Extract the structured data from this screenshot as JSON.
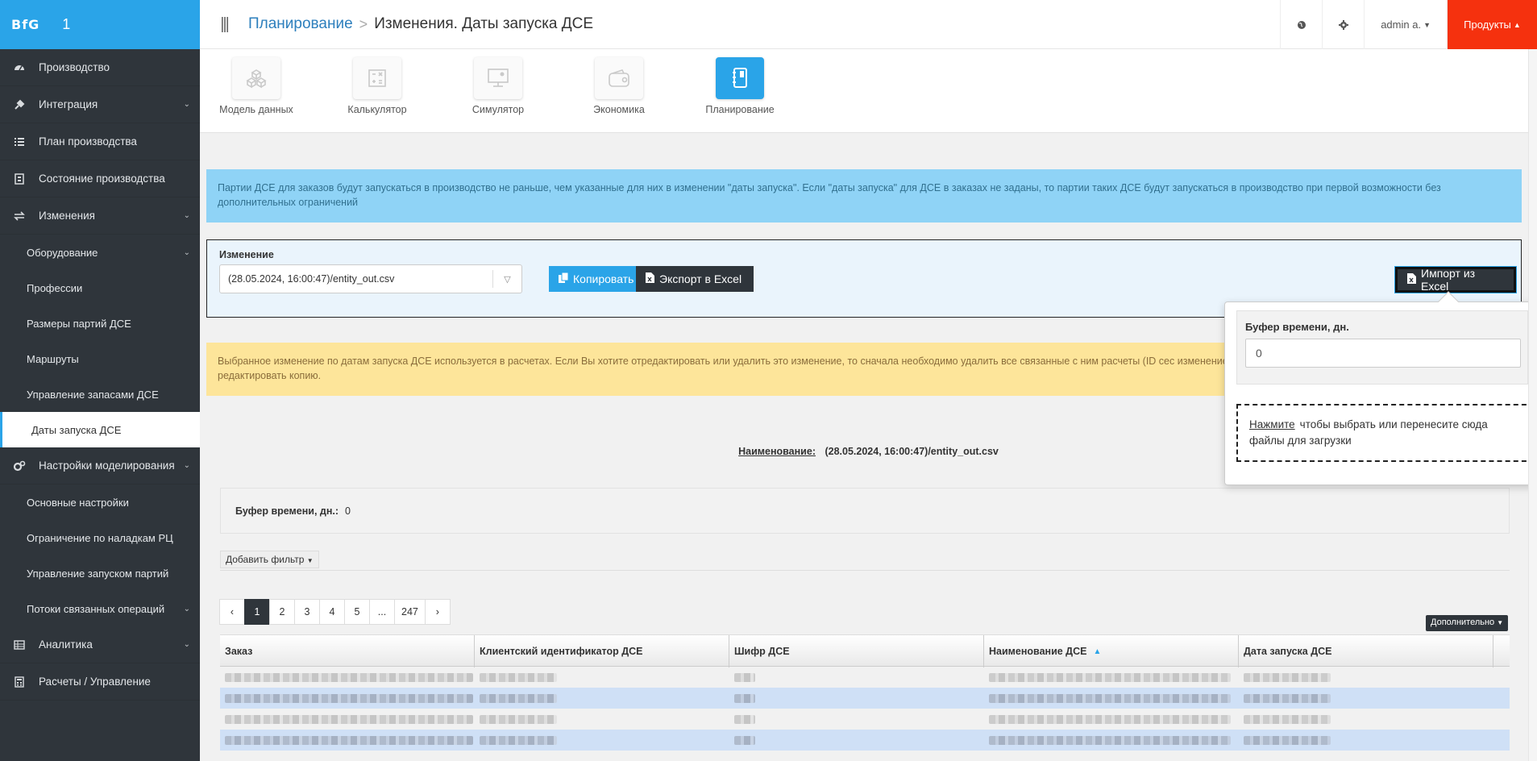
{
  "app": {
    "logo": "BfG",
    "number": "1"
  },
  "header": {
    "breadcrumb_link": "Планирование",
    "breadcrumb_sep": ">",
    "breadcrumb_current": "Изменения. Даты запуска ДСЕ",
    "user": "admin a.",
    "products": "Продукты"
  },
  "sidebar": {
    "items": [
      {
        "label": "Производство",
        "icon": "dashboard-icon"
      },
      {
        "label": "Интеграция",
        "icon": "plug-icon"
      },
      {
        "label": "План производства",
        "icon": "list-icon"
      },
      {
        "label": "Состояние производства",
        "icon": "building-icon"
      },
      {
        "label": "Изменения",
        "icon": "exchange-icon"
      }
    ],
    "sub_changes": [
      "Оборудование",
      "Профессии",
      "Размеры партий ДСЕ",
      "Маршруты",
      "Управление запасами ДСЕ",
      "Даты запуска ДСЕ"
    ],
    "settings": {
      "label": "Настройки моделирования",
      "icon": "gears-icon"
    },
    "sub_settings": [
      "Основные настройки",
      "Ограничение по наладкам РЦ",
      "Управление запуском партий",
      "Потоки связанных операций"
    ],
    "analytics": {
      "label": "Аналитика",
      "icon": "table-icon"
    },
    "calcs": {
      "label": "Расчеты / Управление",
      "icon": "calculator-icon"
    }
  },
  "products": [
    {
      "label": "Модель данных",
      "icon": "cubes-icon"
    },
    {
      "label": "Калькулятор",
      "icon": "calculator-icon"
    },
    {
      "label": "Симулятор",
      "icon": "monitor-icon"
    },
    {
      "label": "Экономика",
      "icon": "wallet-icon"
    },
    {
      "label": "Планирование",
      "icon": "notebook-icon"
    }
  ],
  "info": "Партии ДСЕ для заказов будут запускаться в производство не раньше, чем указанные для них в изменении \"даты запуска\". Если \"даты запуска\" для ДСЕ в заказах не заданы, то партии таких ДСЕ будут запускаться в производство при первой возможности без дополнительных ограничений",
  "panel": {
    "label": "Изменение",
    "selected": "(28.05.2024, 16:00:47)/entity_out.csv",
    "copy": "Копировать",
    "export": "Экспорт в Excel",
    "import": "Импорт из Excel"
  },
  "warning": "Выбранное изменение по датам запуска ДСЕ используется в расчетах. Если Вы хотите отредактировать или удалить это изменение, то сначала необходимо удалить все связанные с ним расчеты (ID сес изменение и редактировать копию.",
  "name": {
    "key": "Наименование:",
    "value": "(28.05.2024, 16:00:47)/entity_out.csv"
  },
  "buffer": {
    "key": "Буфер времени, дн.:",
    "value": "0"
  },
  "filter": "Добавить фильтр",
  "pager": [
    "‹",
    "1",
    "2",
    "3",
    "4",
    "5",
    "...",
    "247",
    "›"
  ],
  "more": "Дополнительно",
  "table": {
    "columns": [
      "Заказ",
      "Клиентский идентификатор ДСЕ",
      "Шифр ДСЕ",
      "Наименование ДСЕ",
      "Дата запуска ДСЕ"
    ],
    "sort_column": "Наименование ДСЕ"
  },
  "popover": {
    "label": "Буфер времени, дн.",
    "value": "0",
    "link": "Нажмите",
    "text": "чтобы выбрать или перенесите сюда файлы для загрузки"
  },
  "colors": {
    "accent": "#2aa4e8",
    "sidebar": "#2f353b",
    "products": "#f5310e",
    "info": "#8fd3f6",
    "warning": "#fde59a"
  }
}
